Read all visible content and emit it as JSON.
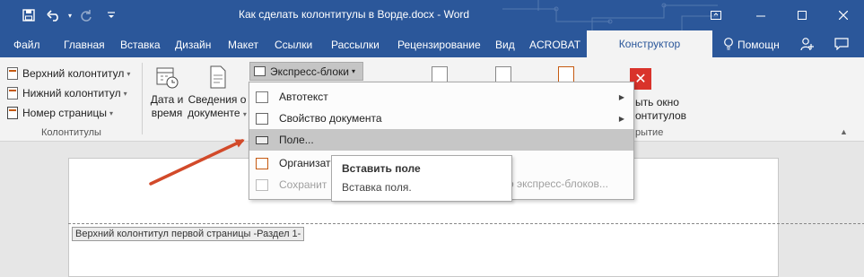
{
  "window": {
    "title": "Как сделать колонтитулы в Ворде.docx - Word"
  },
  "qat": {
    "save_icon": "save-icon",
    "undo_icon": "undo-icon",
    "redo_icon": "redo-icon",
    "customize_icon": "customize-qat-icon"
  },
  "tabs": [
    "Файл",
    "Главная",
    "Вставка",
    "Дизайн",
    "Макет",
    "Ссылки",
    "Рассылки",
    "Рецензирование",
    "Вид",
    "ACROBAT"
  ],
  "active_tab": "Конструктор",
  "help": "Помощн",
  "ribbon": {
    "header": "Верхний колонтитул",
    "footer": "Нижний колонтитул",
    "page_number": "Номер страницы",
    "group_hf": "Колонтитулы",
    "date_time": "Дата и время",
    "date_time_line1": "Дата и",
    "date_time_line2": "время",
    "doc_info_line1": "Сведения о",
    "doc_info_line2": "документе",
    "express_blocks": "Экспресс-блоки",
    "close_line1": "ыть окно",
    "close_line2": "онтитулов",
    "close_group": "рытие"
  },
  "menu": {
    "items": [
      {
        "label": "Автотекст",
        "submenu": true
      },
      {
        "label": "Свойство документа",
        "submenu": true
      },
      {
        "label": "Поле...",
        "submenu": false,
        "highlight": true
      },
      {
        "label": "Организат",
        "submenu": false
      },
      {
        "label": "Сохранит",
        "submenu": false,
        "disabled": true
      }
    ],
    "tail_text": "о экспресс-блоков..."
  },
  "tooltip": {
    "title": "Вставить поле",
    "desc": "Вставка поля."
  },
  "document": {
    "header_label": "Верхний колонтитул первой страницы -Раздел 1-"
  },
  "colors": {
    "title_bar": "#2b579a",
    "highlight": "#c6c6c6",
    "arrow": "#d24a2a",
    "close_button": "#d9332b"
  }
}
